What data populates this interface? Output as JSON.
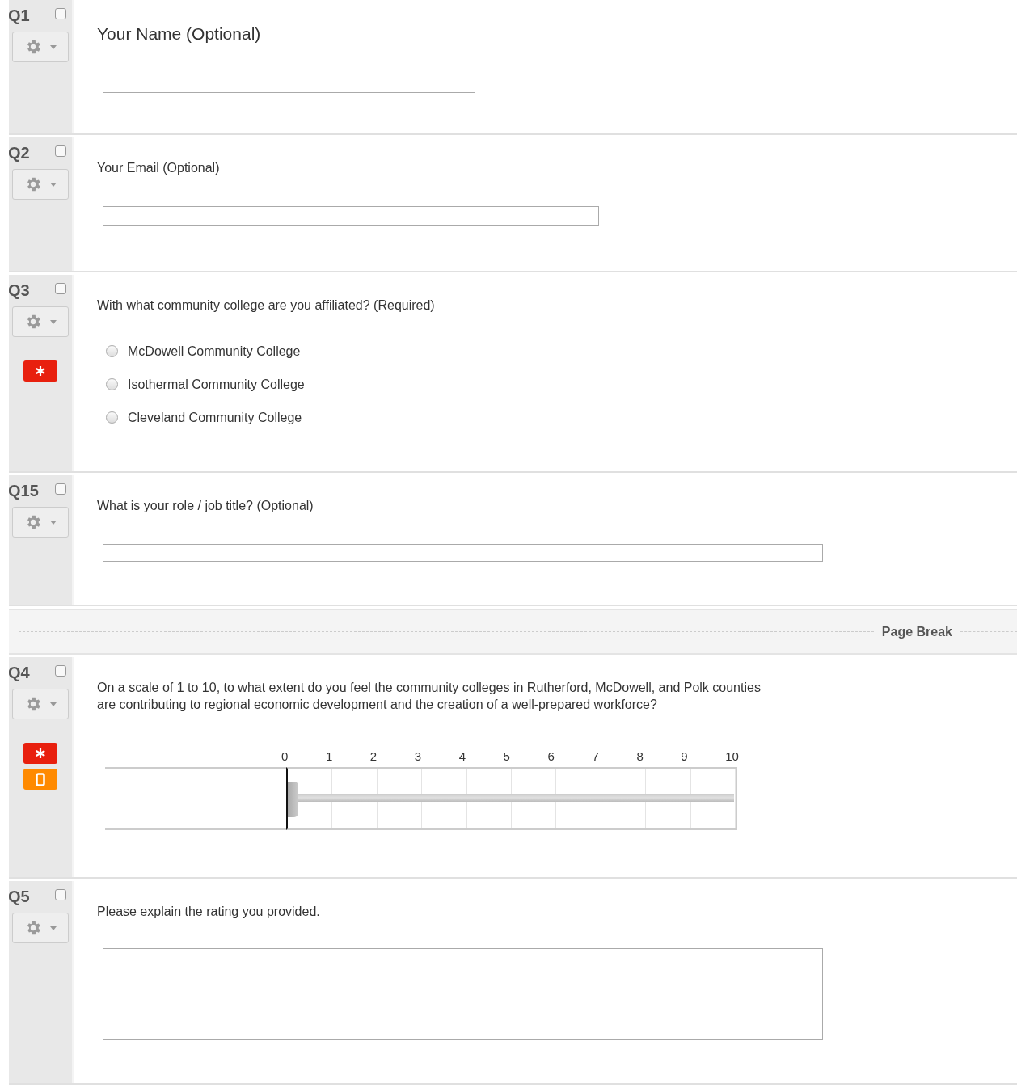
{
  "questions": [
    {
      "kind": "text_entry",
      "number": "Q1",
      "checked": false,
      "required": false,
      "mobile": false,
      "text": "Your Name (Optional)"
    },
    {
      "kind": "text_entry",
      "number": "Q2",
      "checked": false,
      "required": false,
      "mobile": false,
      "text": "Your Email (Optional)"
    },
    {
      "kind": "choice",
      "number": "Q3",
      "checked": false,
      "required": true,
      "mobile": false,
      "text": "With what community college are you affiliated? (Required)",
      "options": [
        {
          "label": "McDowell Community College",
          "selected": false
        },
        {
          "label": "Isothermal Community College",
          "selected": false
        },
        {
          "label": "Cleveland Community College",
          "selected": false
        }
      ]
    },
    {
      "kind": "text_entry",
      "number": "Q15",
      "checked": false,
      "required": false,
      "mobile": false,
      "text": "What is your role / job title?  (Optional)"
    },
    {
      "kind": "page_break",
      "label": "Page Break"
    },
    {
      "kind": "slider",
      "number": "Q4",
      "checked": false,
      "required": true,
      "mobile": true,
      "text": "On a scale of 1 to 10, to what extent do you feel the community colleges in Rutherford, McDowell, and Polk counties are contributing to regional economic development and the creation of a well-prepared workforce?",
      "ticks": [
        "0",
        "1",
        "2",
        "3",
        "4",
        "5",
        "6",
        "7",
        "8",
        "9",
        "10"
      ],
      "level": 0
    },
    {
      "kind": "essay",
      "number": "Q5",
      "checked": false,
      "required": false,
      "mobile": false,
      "text": "Please explain the rating you provided."
    }
  ]
}
